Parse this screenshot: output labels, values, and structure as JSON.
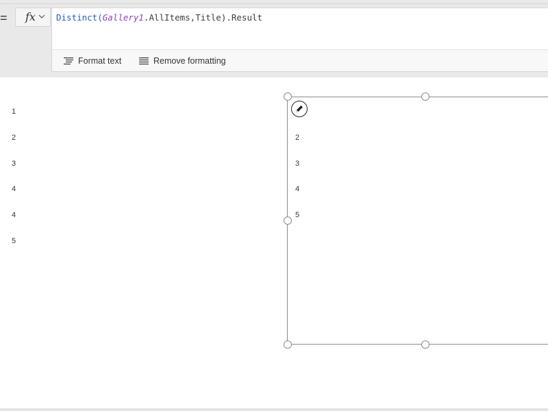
{
  "formula_bar": {
    "equals": "=",
    "fx_label": "fx",
    "formula": {
      "fn": "Distinct(",
      "control": "Gallery1",
      "rest": ".AllItems,Title).Result"
    }
  },
  "toolbar": {
    "format_text_label": "Format text",
    "remove_formatting_label": "Remove formatting"
  },
  "left_gallery": {
    "items": [
      "1",
      "2",
      "3",
      "4",
      "4",
      "5"
    ]
  },
  "selected_gallery": {
    "items": [
      "2",
      "3",
      "4",
      "5"
    ]
  },
  "icons": {
    "fx_dropdown": "chevron-down-icon",
    "format_text": "format-text-icon",
    "remove_formatting": "remove-formatting-icon",
    "edit": "pencil-icon"
  }
}
